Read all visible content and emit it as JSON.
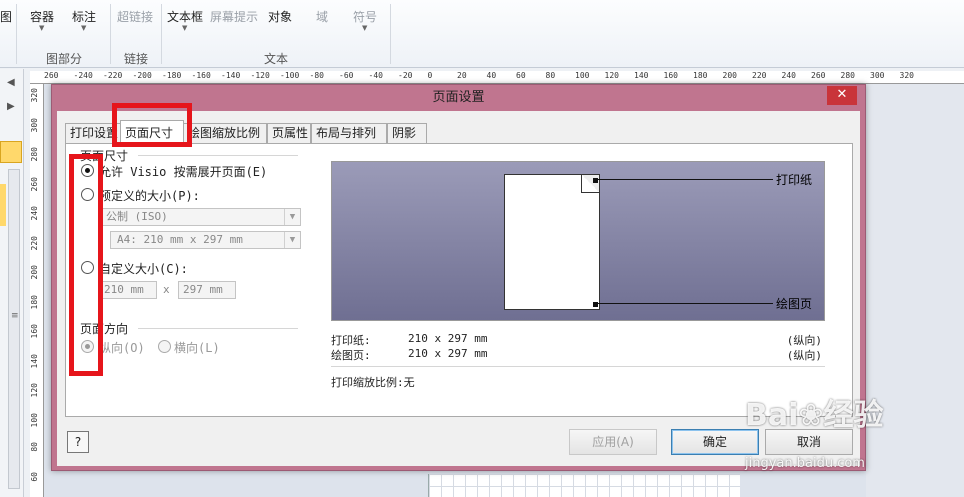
{
  "ribbon": {
    "buttons": [
      {
        "id": "container",
        "label": "容器",
        "has_dropdown": true
      },
      {
        "id": "callout",
        "label": "标注",
        "has_dropdown": true
      },
      {
        "id": "hyperlink",
        "label": "超链接",
        "disabled": true
      },
      {
        "id": "textbox",
        "label": "文本框",
        "has_dropdown": true
      },
      {
        "id": "screentip",
        "label": "屏幕提示",
        "disabled": true
      },
      {
        "id": "object",
        "label": "对象"
      },
      {
        "id": "field",
        "label": "域",
        "disabled": true
      },
      {
        "id": "symbol",
        "label": "符号",
        "disabled": true,
        "has_dropdown": true
      }
    ],
    "partial_left_label": "图",
    "groups": {
      "diagram_parts": "图部分",
      "links": "链接",
      "text": "文本"
    }
  },
  "hruler_ticks": [
    "260",
    "-240",
    "-220",
    "-200",
    "-180",
    "-160",
    "-140",
    "-120",
    "-100",
    "-80",
    "-60",
    "-40",
    "-20",
    "0",
    "20",
    "40",
    "60",
    "80",
    "100",
    "120",
    "140",
    "160",
    "180",
    "200",
    "220",
    "240",
    "260",
    "280",
    "300",
    "320"
  ],
  "vruler_ticks": [
    "320",
    "300",
    "280",
    "260",
    "240",
    "220",
    "200",
    "180",
    "160",
    "140",
    "120",
    "100",
    "80",
    "60"
  ],
  "dialog": {
    "title": "页面设置",
    "close_label": "✕",
    "tabs": [
      {
        "label": "打印设置",
        "active": false
      },
      {
        "label": "页面尺寸",
        "active": true
      },
      {
        "label": "绘图缩放比例",
        "active": false
      },
      {
        "label": "页属性",
        "active": false
      },
      {
        "label": "布局与排列",
        "active": false
      },
      {
        "label": "阴影",
        "active": false
      }
    ],
    "page_size": {
      "group_label": "页面尺寸",
      "opt_auto": "允许 Visio 按需展开页面(E)",
      "opt_predefined": "预定义的大小(P):",
      "predef_standard": "公制 (ISO)",
      "predef_size": "A4:  210 mm x 297 mm",
      "opt_custom": "自定义大小(C):",
      "custom_width": "210 mm",
      "custom_x": "x",
      "custom_height": "297 mm",
      "selected": "auto"
    },
    "orientation": {
      "group_label": "页面方向",
      "portrait": "纵向(O)",
      "landscape": "横向(L)",
      "selected": "portrait",
      "disabled": true
    },
    "preview": {
      "printer_paper_label": "打印纸",
      "drawing_page_label": "绘图页"
    },
    "info": {
      "printer_paper_label": "打印纸:",
      "printer_paper_value": "210 x 297 mm",
      "printer_paper_orient": "(纵向)",
      "drawing_page_label": "绘图页:",
      "drawing_page_value": "210 x 297 mm",
      "drawing_page_orient": "(纵向)",
      "print_zoom": "打印缩放比例:无"
    },
    "buttons": {
      "help": "?",
      "apply": "应用(A)",
      "ok": "确定",
      "cancel": "取消"
    }
  },
  "watermark": {
    "brand": "Bai❀经验",
    "url": "jingyan.baidu.com"
  },
  "colors": {
    "dialog_frame": "#c0758f",
    "close_button": "#c9343a",
    "highlight": "#e6151b"
  }
}
